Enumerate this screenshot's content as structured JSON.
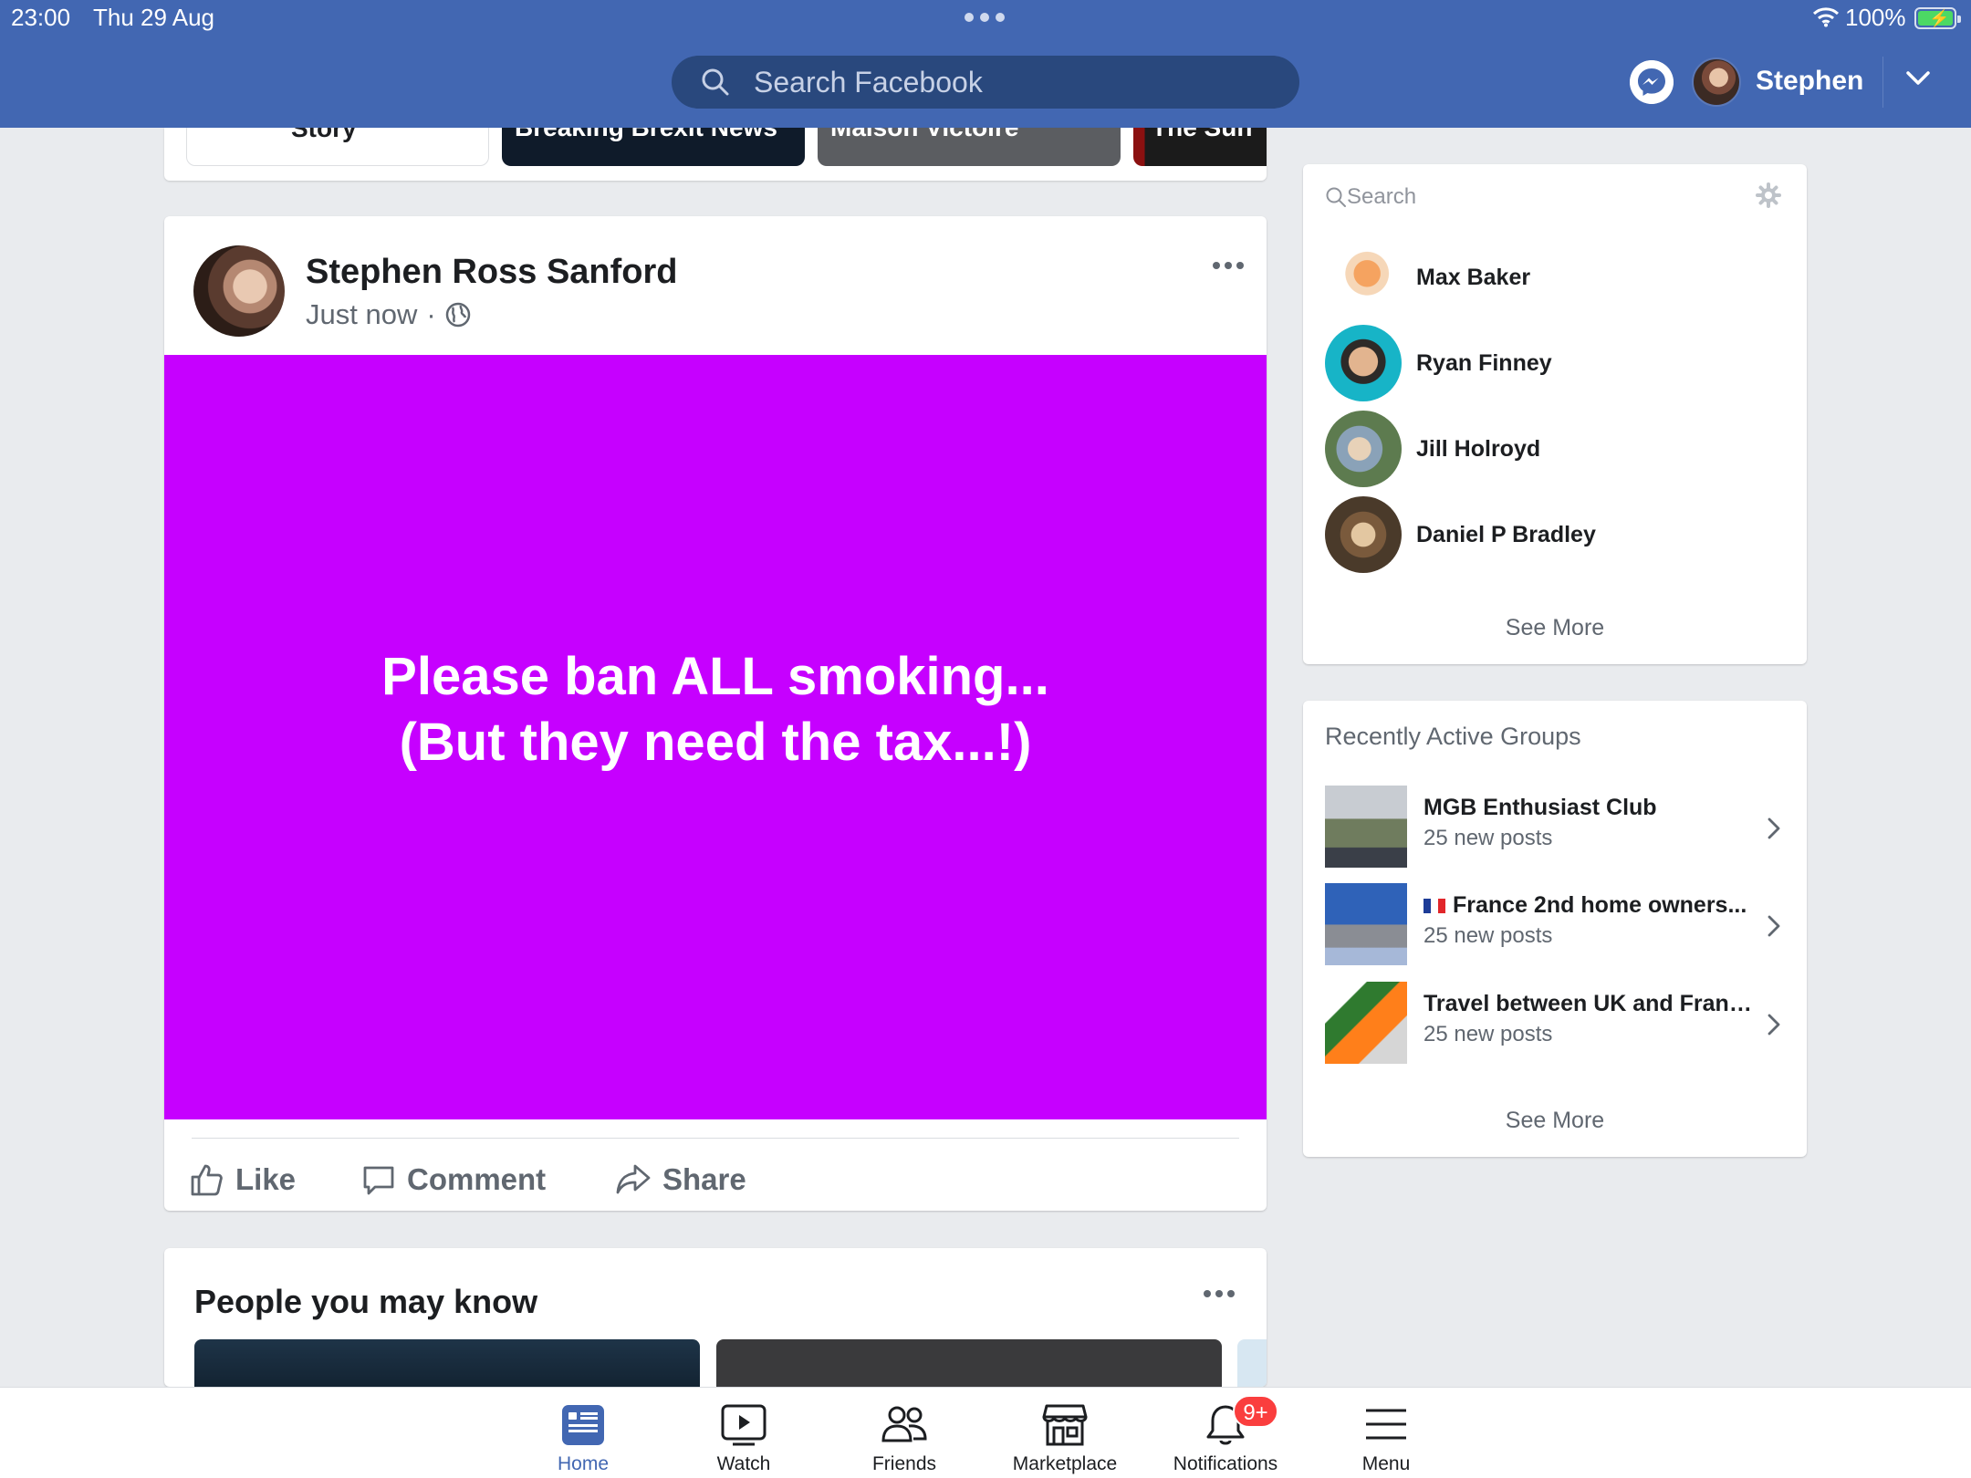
{
  "status_bar": {
    "time": "23:00",
    "date": "Thu 29 Aug",
    "battery": "100%"
  },
  "header": {
    "search_placeholder": "Search Facebook",
    "user_name": "Stephen"
  },
  "stories": [
    {
      "label": "Story"
    },
    {
      "label": "Breaking Brexit News"
    },
    {
      "label": "Maison Victoire"
    },
    {
      "label": "The Sun"
    }
  ],
  "post": {
    "author": "Stephen Ross Sanford",
    "time": "Just now",
    "separator": "·",
    "text": "Please ban ALL smoking...\n(But they need the tax...!)",
    "background_color": "#c600ff",
    "actions": {
      "like": "Like",
      "comment": "Comment",
      "share": "Share"
    }
  },
  "pymk": {
    "title": "People you may know"
  },
  "contacts": {
    "search_placeholder": "Search",
    "items": [
      {
        "name": "Max Baker"
      },
      {
        "name": "Ryan Finney"
      },
      {
        "name": "Jill Holroyd"
      },
      {
        "name": "Daniel P Bradley"
      }
    ],
    "see_more": "See More"
  },
  "groups": {
    "title": "Recently Active Groups",
    "items": [
      {
        "name": "MGB Enthusiast Club",
        "posts": "25 new posts"
      },
      {
        "name": "France 2nd home owners...",
        "posts": "25 new posts"
      },
      {
        "name": "Travel between UK and France",
        "posts": "25 new posts"
      }
    ],
    "see_more": "See More"
  },
  "tabbar": {
    "home": "Home",
    "watch": "Watch",
    "friends": "Friends",
    "marketplace": "Marketplace",
    "notifications": "Notifications",
    "notifications_badge": "9+",
    "menu": "Menu"
  },
  "colors": {
    "brand": "#4267b2",
    "post_background": "#c600ff",
    "badge": "#fa3e3e"
  }
}
